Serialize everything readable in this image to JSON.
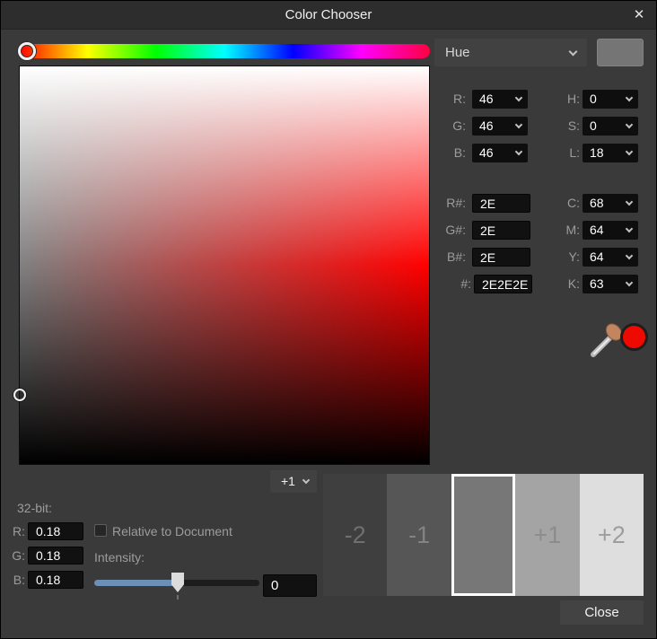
{
  "window": {
    "title": "Color Chooser",
    "close_icon": "✕"
  },
  "top_bar": {
    "mode_value": "Hue",
    "swatch_color": "#757575"
  },
  "channels": {
    "rgb": [
      {
        "label": "R:",
        "value": "46"
      },
      {
        "label": "G:",
        "value": "46"
      },
      {
        "label": "B:",
        "value": "46"
      }
    ],
    "hsl": [
      {
        "label": "H:",
        "value": "0"
      },
      {
        "label": "S:",
        "value": "0"
      },
      {
        "label": "L:",
        "value": "18"
      }
    ],
    "hex": [
      {
        "label": "R#:",
        "value": "2E"
      },
      {
        "label": "G#:",
        "value": "2E"
      },
      {
        "label": "B#:",
        "value": "2E"
      },
      {
        "label": "#:",
        "value": "2E2E2E"
      }
    ],
    "cmyk": [
      {
        "label": "C:",
        "value": "68"
      },
      {
        "label": "M:",
        "value": "64"
      },
      {
        "label": "Y:",
        "value": "64"
      },
      {
        "label": "K:",
        "value": "63"
      }
    ]
  },
  "picker": {
    "dot_color": "#ee0a00"
  },
  "noise_dropdown": {
    "value": "+1"
  },
  "bit32": {
    "section_label": "32-bit:",
    "fields": [
      {
        "label": "R:",
        "value": "0.18"
      },
      {
        "label": "G:",
        "value": "0.18"
      },
      {
        "label": "B:",
        "value": "0.18"
      }
    ],
    "relative_checkbox_label": "Relative to Document",
    "relative_checked": false,
    "intensity_label": "Intensity:",
    "intensity_value": "0",
    "slider_fill_color": "#6b8fb5"
  },
  "swatches": [
    {
      "label": "-2",
      "color": "#3f3f3f",
      "label_color": "#6f6f6f",
      "selected": false
    },
    {
      "label": "-1",
      "color": "#565656",
      "label_color": "#838383",
      "selected": false
    },
    {
      "label": "",
      "color": "#777777",
      "label_color": "#777777",
      "selected": true
    },
    {
      "label": "+1",
      "color": "#a4a4a4",
      "label_color": "#8c8c8c",
      "selected": false
    },
    {
      "label": "+2",
      "color": "#dedede",
      "label_color": "#9d9d9d",
      "selected": false
    }
  ],
  "close_button_label": "Close"
}
